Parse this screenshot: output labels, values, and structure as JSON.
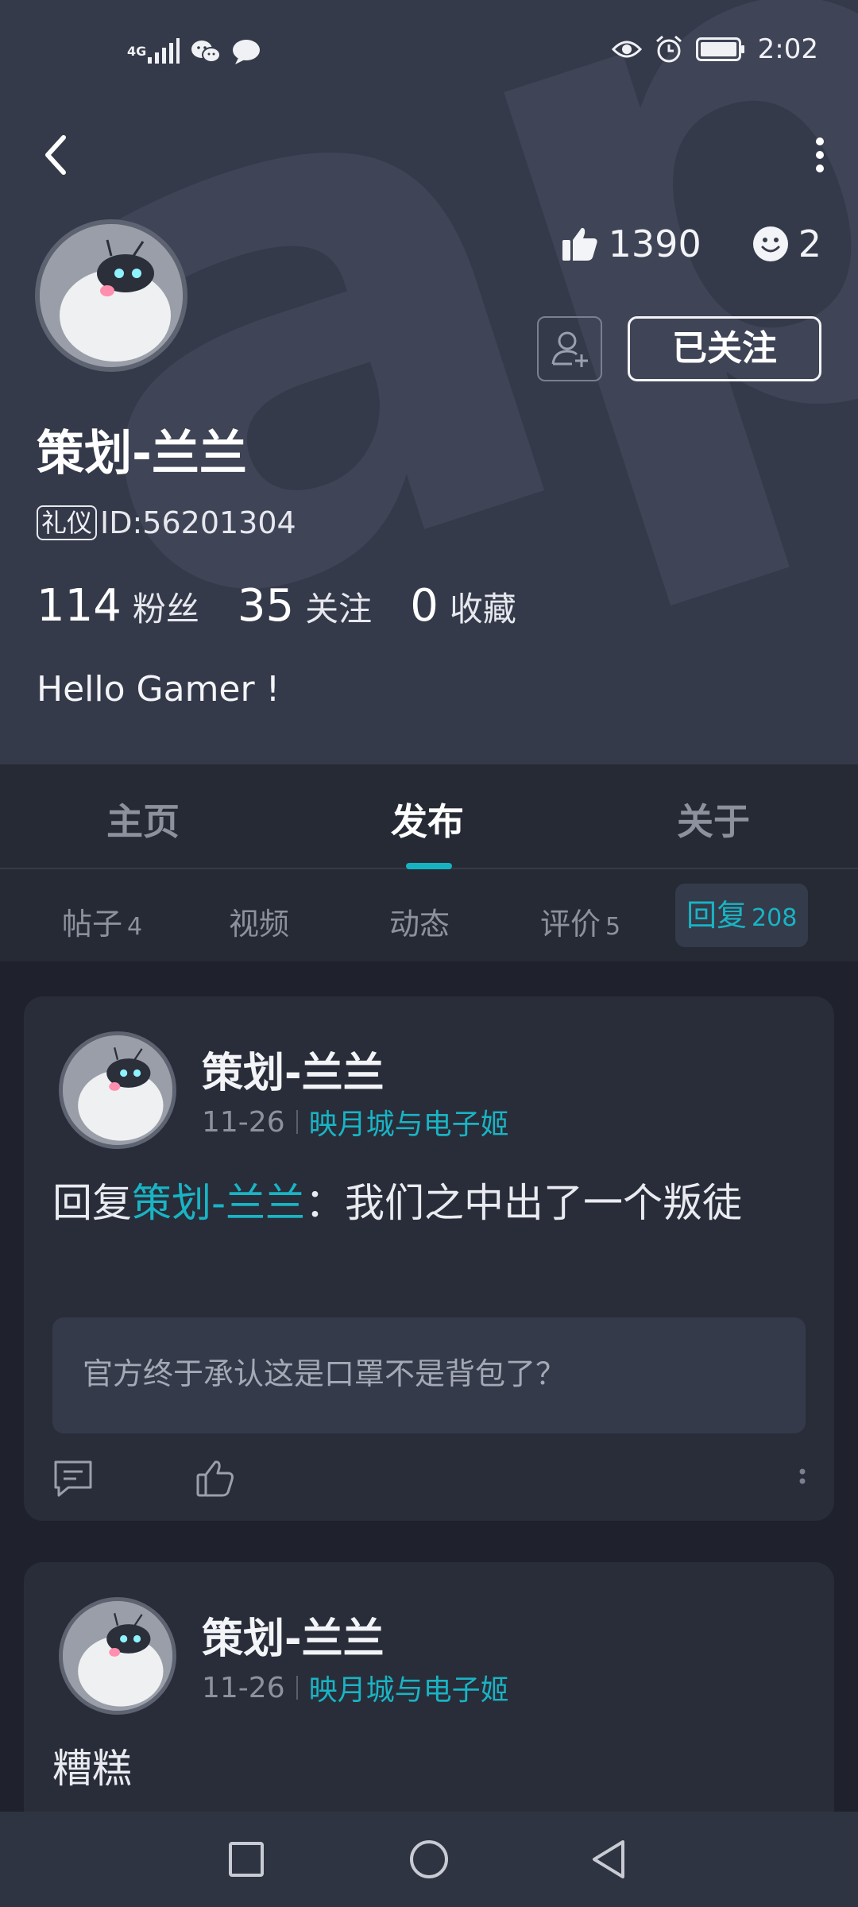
{
  "status_bar": {
    "network": "4G",
    "time": "2:02"
  },
  "profile": {
    "likes": "1390",
    "emoji_count": "2",
    "follow_label": "已关注",
    "name": "策划-兰兰",
    "tag": "礼仪",
    "id": "ID:56201304",
    "followers_count": "114",
    "followers_label": "粉丝",
    "following_count": "35",
    "following_label": "关注",
    "favorites_count": "0",
    "favorites_label": "收藏",
    "bio": "Hello Gamer !"
  },
  "tabs": [
    {
      "label": "主页"
    },
    {
      "label": "发布"
    },
    {
      "label": "关于"
    }
  ],
  "subtabs": [
    {
      "label": "帖子",
      "count": "4"
    },
    {
      "label": "视频"
    },
    {
      "label": "动态"
    },
    {
      "label": "评价",
      "count": "5"
    },
    {
      "label": "回复",
      "count": "208"
    }
  ],
  "posts": [
    {
      "author": "策划-兰兰",
      "date": "11-26",
      "game": "映月城与电子姬",
      "reply_prefix": "回复",
      "reply_target": "策划-兰兰",
      "body": "：我们之中出了一个叛徒",
      "quote": "官方终于承认这是口罩不是背包了？"
    },
    {
      "author": "策划-兰兰",
      "date": "11-26",
      "game": "映月城与电子姬",
      "body": "糟糕"
    }
  ],
  "colors": {
    "accent": "#19b4c4",
    "header_bg": "#353a4a",
    "page_bg": "#1f222c",
    "card_bg": "#292d39"
  }
}
